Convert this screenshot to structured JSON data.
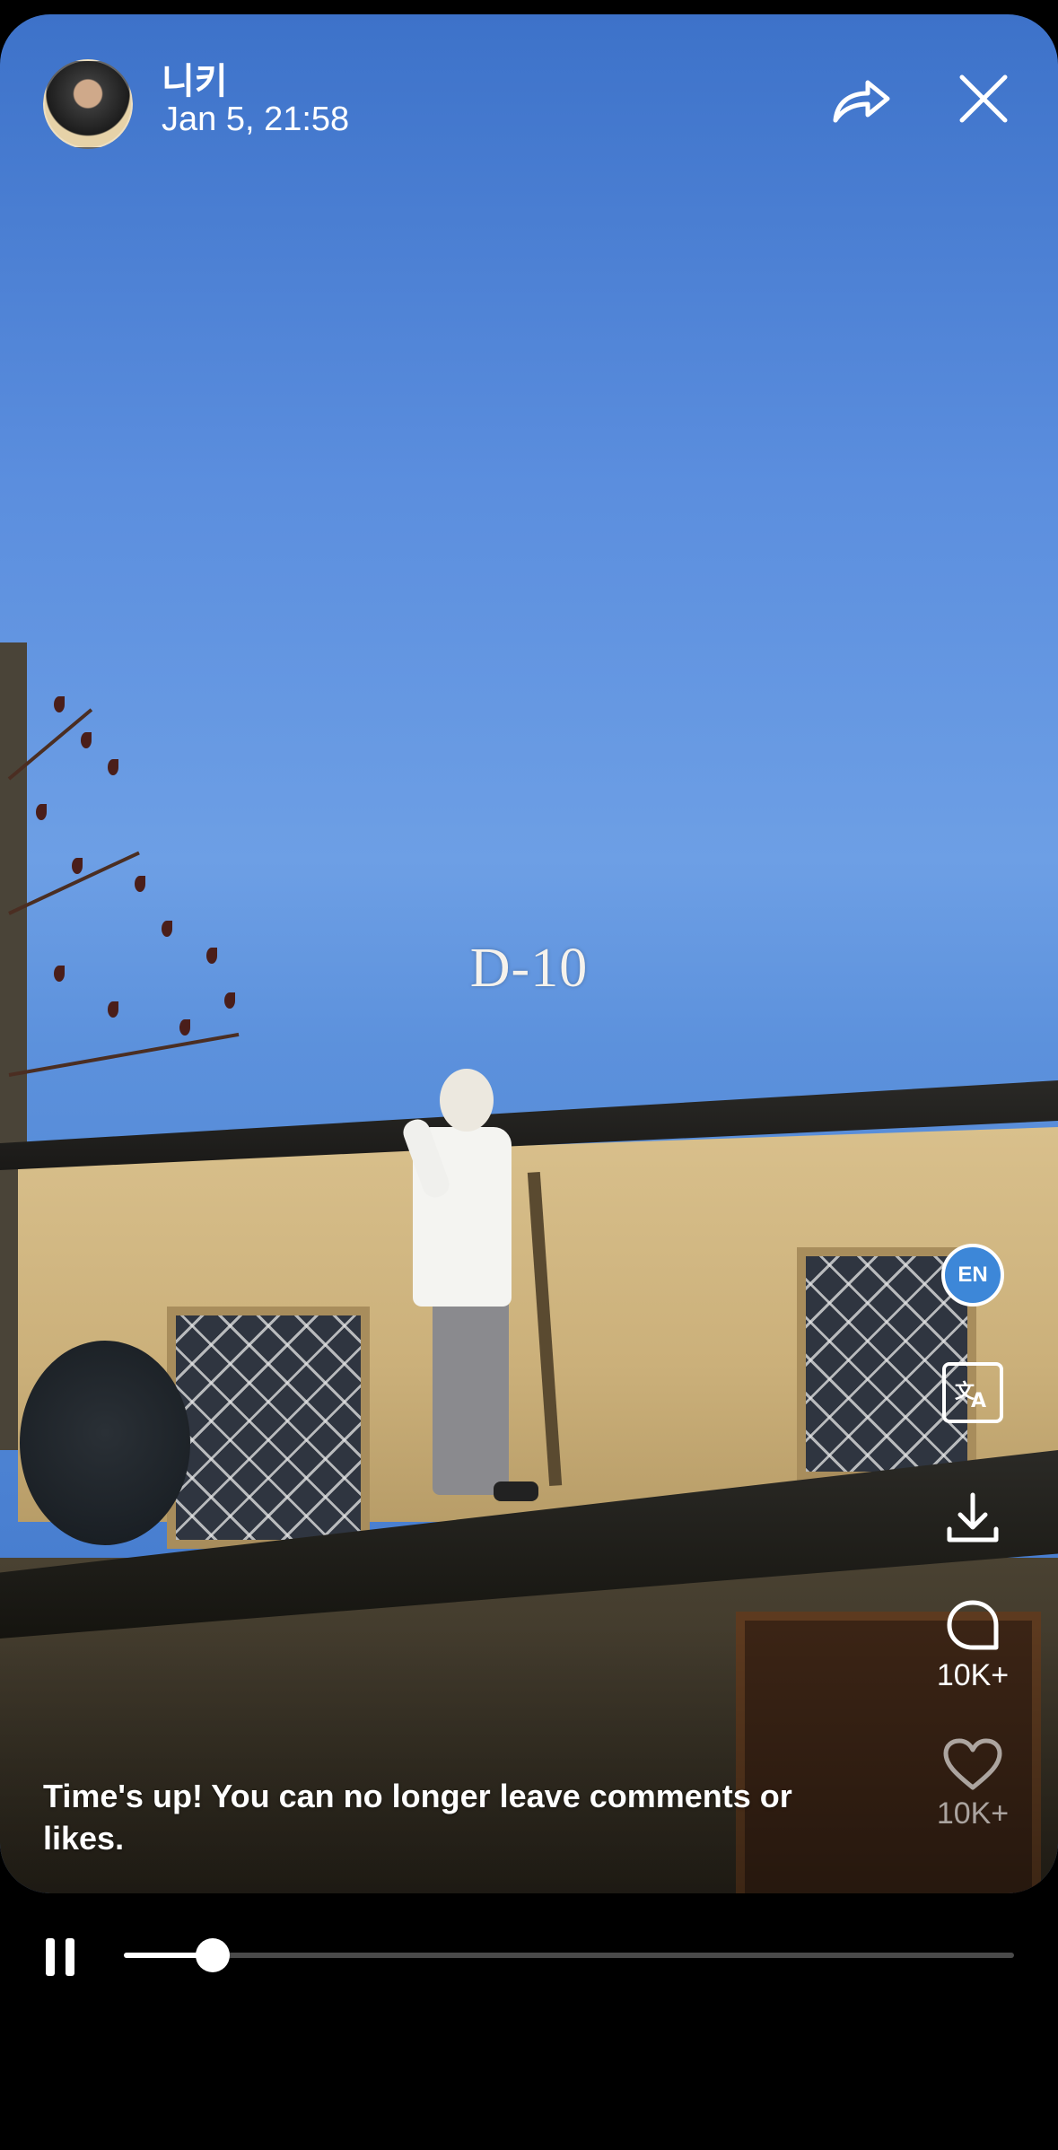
{
  "header": {
    "username": "니키",
    "timestamp": "Jan 5, 21:58"
  },
  "media": {
    "overlay_text": "D-10"
  },
  "right_rail": {
    "group_badge": "EN",
    "translate_icon": "translate-icon",
    "download_icon": "download-icon",
    "comment_count": "10K+",
    "like_count": "10K+"
  },
  "notice": "Time's up! You can no longer leave comments or likes.",
  "player": {
    "progress": 0.1
  },
  "colors": {
    "sky": "#5b8ede",
    "badge": "#3d87d8",
    "background": "#000000"
  }
}
